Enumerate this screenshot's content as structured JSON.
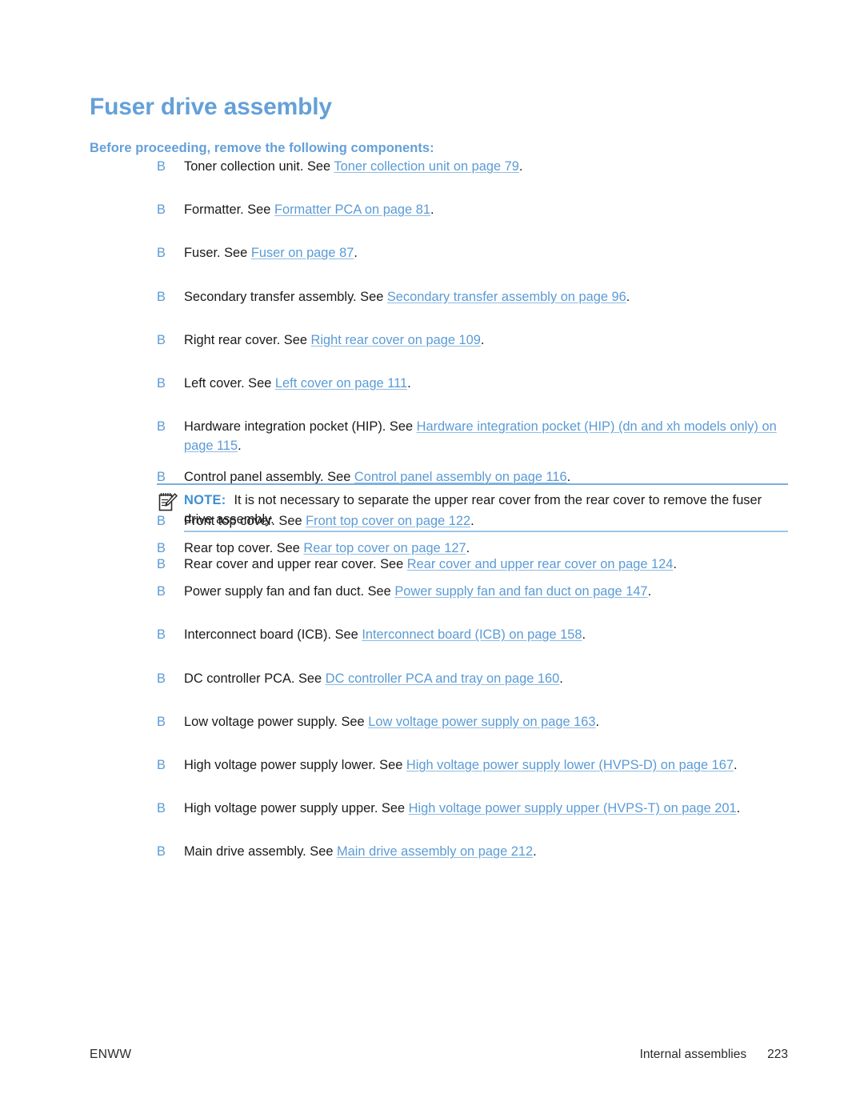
{
  "page": {
    "title": "Fuser drive assembly",
    "subtitle": "Before proceeding, remove the following components:",
    "bullet_marker": "B",
    "colors": {
      "heading_blue": "#64a0d8",
      "link_blue": "#5b9bd5",
      "bullet_blue": "#5b9bd5",
      "note_label_blue": "#3f8fd2",
      "rule_blue": "#79aedd",
      "body_text": "#1a1a1a",
      "background": "#ffffff"
    }
  },
  "components": [
    {
      "prefix": "Toner collection unit. See ",
      "link": "Toner collection unit on page 79",
      "suffix": "."
    },
    {
      "prefix": "Formatter. See ",
      "link": "Formatter PCA on page 81",
      "suffix": "."
    },
    {
      "prefix": "Fuser. See ",
      "link": "Fuser on page 87",
      "suffix": "."
    },
    {
      "prefix": "Secondary transfer assembly. See ",
      "link": "Secondary transfer assembly on page 96",
      "suffix": "."
    },
    {
      "prefix": "Right rear cover. See ",
      "link": "Right rear cover on page 109",
      "suffix": "."
    },
    {
      "prefix": "Left cover. See ",
      "link": "Left cover on page 111",
      "suffix": "."
    },
    {
      "prefix": "Hardware integration pocket (HIP). See ",
      "link": "Hardware integration pocket (HIP) (dn and xh models only) on page 115",
      "suffix": "."
    },
    {
      "prefix": "Control panel assembly. See ",
      "link": "Control panel assembly on page 116",
      "suffix": "."
    },
    {
      "prefix": "Front top cover. See ",
      "link": "Front top cover on page 122",
      "suffix": "."
    },
    {
      "prefix": "Rear cover and upper rear cover. See ",
      "link": "Rear cover and upper rear cover on page 124",
      "suffix": "."
    }
  ],
  "note": {
    "icon": "notepad-pencil-icon",
    "label": "NOTE:",
    "text": "It is not necessary to separate the upper rear cover from the rear cover to remove the fuser drive assembly."
  },
  "components_after_note": [
    {
      "prefix": "Rear top cover. See ",
      "link": "Rear top cover on page 127",
      "suffix": "."
    },
    {
      "prefix": "Power supply fan and fan duct. See ",
      "link": "Power supply fan and fan duct on page 147",
      "suffix": "."
    },
    {
      "prefix": "Interconnect board (ICB). See ",
      "link": "Interconnect board (ICB) on page 158",
      "suffix": "."
    },
    {
      "prefix": "DC controller PCA. See ",
      "link": "DC controller PCA and tray on page 160",
      "suffix": "."
    },
    {
      "prefix": "Low voltage power supply. See ",
      "link": "Low voltage power supply on page 163",
      "suffix": "."
    },
    {
      "prefix": "High voltage power supply lower. See ",
      "link": "High voltage power supply lower (HVPS-D) on page 167",
      "suffix": "."
    },
    {
      "prefix": "High voltage power supply upper. See ",
      "link": "High voltage power supply upper (HVPS-T) on page 201",
      "suffix": "."
    },
    {
      "prefix": "Main drive assembly. See ",
      "link": "Main drive assembly on page 212",
      "suffix": "."
    }
  ],
  "footer": {
    "left": "ENWW",
    "section": "Internal assemblies",
    "page_number": "223"
  }
}
